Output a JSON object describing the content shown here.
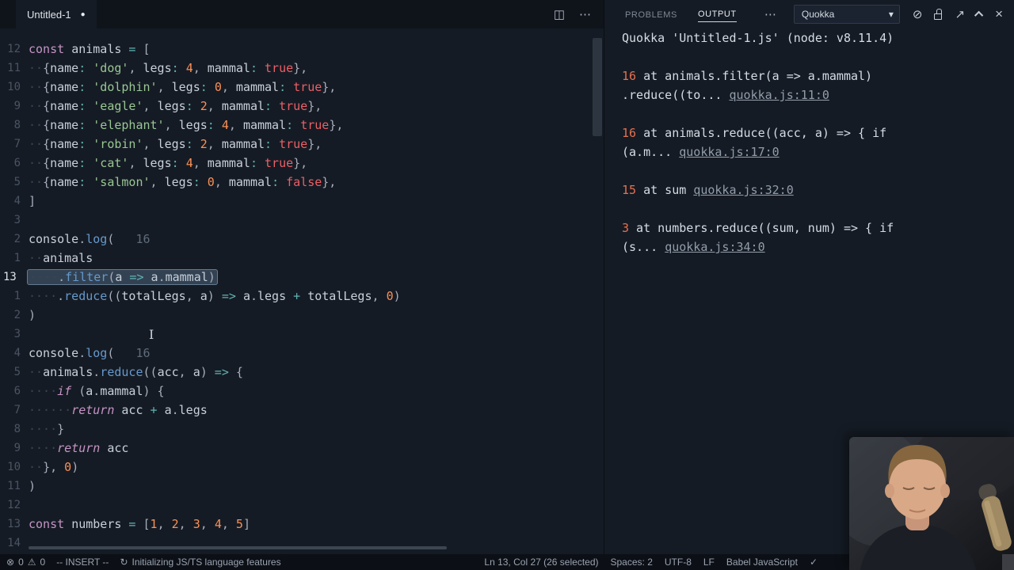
{
  "tab": {
    "title": "Untitled-1",
    "dirty_dot": "●"
  },
  "icons": {
    "split_editor": "◫",
    "more": "⋯",
    "caret": "▾",
    "clear_output": "⊘",
    "open_log": "↗",
    "close_panel": "×"
  },
  "editor": {
    "lines": [
      {
        "n": "12",
        "t": [
          [
            "kw",
            "const"
          ],
          [
            "pn",
            " "
          ],
          [
            "id",
            "animals"
          ],
          [
            "op",
            " = "
          ],
          [
            "pn",
            "["
          ]
        ]
      },
      {
        "n": "11",
        "t": [
          [
            "ws",
            "··"
          ],
          [
            "pn",
            "{"
          ],
          [
            "id",
            "name"
          ],
          [
            "op",
            ":"
          ],
          [
            "pn",
            " "
          ],
          [
            "str",
            "'dog'"
          ],
          [
            "pn",
            ", "
          ],
          [
            "id",
            "legs"
          ],
          [
            "op",
            ":"
          ],
          [
            "pn",
            " "
          ],
          [
            "num",
            "4"
          ],
          [
            "pn",
            ", "
          ],
          [
            "id",
            "mammal"
          ],
          [
            "op",
            ":"
          ],
          [
            "pn",
            " "
          ],
          [
            "bool",
            "true"
          ],
          [
            "pn",
            "},"
          ]
        ]
      },
      {
        "n": "10",
        "t": [
          [
            "ws",
            "··"
          ],
          [
            "pn",
            "{"
          ],
          [
            "id",
            "name"
          ],
          [
            "op",
            ":"
          ],
          [
            "pn",
            " "
          ],
          [
            "str",
            "'dolphin'"
          ],
          [
            "pn",
            ", "
          ],
          [
            "id",
            "legs"
          ],
          [
            "op",
            ":"
          ],
          [
            "pn",
            " "
          ],
          [
            "num",
            "0"
          ],
          [
            "pn",
            ", "
          ],
          [
            "id",
            "mammal"
          ],
          [
            "op",
            ":"
          ],
          [
            "pn",
            " "
          ],
          [
            "bool",
            "true"
          ],
          [
            "pn",
            "},"
          ]
        ]
      },
      {
        "n": "9",
        "t": [
          [
            "ws",
            "··"
          ],
          [
            "pn",
            "{"
          ],
          [
            "id",
            "name"
          ],
          [
            "op",
            ":"
          ],
          [
            "pn",
            " "
          ],
          [
            "str",
            "'eagle'"
          ],
          [
            "pn",
            ", "
          ],
          [
            "id",
            "legs"
          ],
          [
            "op",
            ":"
          ],
          [
            "pn",
            " "
          ],
          [
            "num",
            "2"
          ],
          [
            "pn",
            ", "
          ],
          [
            "id",
            "mammal"
          ],
          [
            "op",
            ":"
          ],
          [
            "pn",
            " "
          ],
          [
            "bool",
            "true"
          ],
          [
            "pn",
            "},"
          ]
        ]
      },
      {
        "n": "8",
        "t": [
          [
            "ws",
            "··"
          ],
          [
            "pn",
            "{"
          ],
          [
            "id",
            "name"
          ],
          [
            "op",
            ":"
          ],
          [
            "pn",
            " "
          ],
          [
            "str",
            "'elephant'"
          ],
          [
            "pn",
            ", "
          ],
          [
            "id",
            "legs"
          ],
          [
            "op",
            ":"
          ],
          [
            "pn",
            " "
          ],
          [
            "num",
            "4"
          ],
          [
            "pn",
            ", "
          ],
          [
            "id",
            "mammal"
          ],
          [
            "op",
            ":"
          ],
          [
            "pn",
            " "
          ],
          [
            "bool",
            "true"
          ],
          [
            "pn",
            "},"
          ]
        ]
      },
      {
        "n": "7",
        "t": [
          [
            "ws",
            "··"
          ],
          [
            "pn",
            "{"
          ],
          [
            "id",
            "name"
          ],
          [
            "op",
            ":"
          ],
          [
            "pn",
            " "
          ],
          [
            "str",
            "'robin'"
          ],
          [
            "pn",
            ", "
          ],
          [
            "id",
            "legs"
          ],
          [
            "op",
            ":"
          ],
          [
            "pn",
            " "
          ],
          [
            "num",
            "2"
          ],
          [
            "pn",
            ", "
          ],
          [
            "id",
            "mammal"
          ],
          [
            "op",
            ":"
          ],
          [
            "pn",
            " "
          ],
          [
            "bool",
            "true"
          ],
          [
            "pn",
            "},"
          ]
        ]
      },
      {
        "n": "6",
        "t": [
          [
            "ws",
            "··"
          ],
          [
            "pn",
            "{"
          ],
          [
            "id",
            "name"
          ],
          [
            "op",
            ":"
          ],
          [
            "pn",
            " "
          ],
          [
            "str",
            "'cat'"
          ],
          [
            "pn",
            ", "
          ],
          [
            "id",
            "legs"
          ],
          [
            "op",
            ":"
          ],
          [
            "pn",
            " "
          ],
          [
            "num",
            "4"
          ],
          [
            "pn",
            ", "
          ],
          [
            "id",
            "mammal"
          ],
          [
            "op",
            ":"
          ],
          [
            "pn",
            " "
          ],
          [
            "bool",
            "true"
          ],
          [
            "pn",
            "},"
          ]
        ]
      },
      {
        "n": "5",
        "t": [
          [
            "ws",
            "··"
          ],
          [
            "pn",
            "{"
          ],
          [
            "id",
            "name"
          ],
          [
            "op",
            ":"
          ],
          [
            "pn",
            " "
          ],
          [
            "str",
            "'salmon'"
          ],
          [
            "pn",
            ", "
          ],
          [
            "id",
            "legs"
          ],
          [
            "op",
            ":"
          ],
          [
            "pn",
            " "
          ],
          [
            "num",
            "0"
          ],
          [
            "pn",
            ", "
          ],
          [
            "id",
            "mammal"
          ],
          [
            "op",
            ":"
          ],
          [
            "pn",
            " "
          ],
          [
            "bool",
            "false"
          ],
          [
            "pn",
            "},"
          ]
        ]
      },
      {
        "n": "4",
        "t": [
          [
            "pn",
            "]"
          ]
        ]
      },
      {
        "n": "3",
        "t": []
      },
      {
        "n": "2",
        "t": [
          [
            "id",
            "console"
          ],
          [
            "pn",
            "."
          ],
          [
            "fn",
            "log"
          ],
          [
            "pn",
            "("
          ],
          [
            "dim",
            "   16"
          ]
        ]
      },
      {
        "n": "1",
        "t": [
          [
            "ws",
            "··"
          ],
          [
            "id",
            "animals"
          ]
        ]
      },
      {
        "n": "13",
        "cur": 1,
        "sel": 1,
        "t": [
          [
            "ws",
            "····"
          ],
          [
            "pn",
            "."
          ],
          [
            "fn",
            "filter"
          ],
          [
            "pn",
            "("
          ],
          [
            "id",
            "a"
          ],
          [
            "op",
            " => "
          ],
          [
            "id",
            "a"
          ],
          [
            "pn",
            "."
          ],
          [
            "id",
            "mammal"
          ],
          [
            "pn",
            ")"
          ]
        ]
      },
      {
        "n": "1",
        "t": [
          [
            "ws",
            "····"
          ],
          [
            "pn",
            "."
          ],
          [
            "fn",
            "reduce"
          ],
          [
            "pn",
            "(("
          ],
          [
            "id",
            "totalLegs"
          ],
          [
            "pn",
            ", "
          ],
          [
            "id",
            "a"
          ],
          [
            "pn",
            ")"
          ],
          [
            "op",
            " => "
          ],
          [
            "id",
            "a"
          ],
          [
            "pn",
            "."
          ],
          [
            "id",
            "legs"
          ],
          [
            "op",
            " + "
          ],
          [
            "id",
            "totalLegs"
          ],
          [
            "pn",
            ", "
          ],
          [
            "num",
            "0"
          ],
          [
            "pn",
            ")"
          ]
        ]
      },
      {
        "n": "2",
        "t": [
          [
            "pn",
            ")"
          ]
        ]
      },
      {
        "n": "3",
        "t": []
      },
      {
        "n": "4",
        "t": [
          [
            "id",
            "console"
          ],
          [
            "pn",
            "."
          ],
          [
            "fn",
            "log"
          ],
          [
            "pn",
            "("
          ],
          [
            "dim",
            "   16"
          ]
        ]
      },
      {
        "n": "5",
        "t": [
          [
            "ws",
            "··"
          ],
          [
            "id",
            "animals"
          ],
          [
            "pn",
            "."
          ],
          [
            "fn",
            "reduce"
          ],
          [
            "pn",
            "(("
          ],
          [
            "id",
            "acc"
          ],
          [
            "pn",
            ", "
          ],
          [
            "id",
            "a"
          ],
          [
            "pn",
            ")"
          ],
          [
            "op",
            " => "
          ],
          [
            "pn",
            "{"
          ]
        ]
      },
      {
        "n": "6",
        "t": [
          [
            "ws",
            "····"
          ],
          [
            "kwi",
            "if"
          ],
          [
            "pn",
            " ("
          ],
          [
            "id",
            "a"
          ],
          [
            "pn",
            "."
          ],
          [
            "id",
            "mammal"
          ],
          [
            "pn",
            ") {"
          ]
        ]
      },
      {
        "n": "7",
        "t": [
          [
            "ws",
            "······"
          ],
          [
            "kwi",
            "return"
          ],
          [
            "pn",
            " "
          ],
          [
            "id",
            "acc"
          ],
          [
            "op",
            " + "
          ],
          [
            "id",
            "a"
          ],
          [
            "pn",
            "."
          ],
          [
            "id",
            "legs"
          ]
        ]
      },
      {
        "n": "8",
        "t": [
          [
            "ws",
            "····"
          ],
          [
            "pn",
            "}"
          ]
        ]
      },
      {
        "n": "9",
        "t": [
          [
            "ws",
            "····"
          ],
          [
            "kwi",
            "return"
          ],
          [
            "pn",
            " "
          ],
          [
            "id",
            "acc"
          ]
        ]
      },
      {
        "n": "10",
        "t": [
          [
            "ws",
            "··"
          ],
          [
            "pn",
            "}, "
          ],
          [
            "num",
            "0"
          ],
          [
            "pn",
            ")"
          ]
        ]
      },
      {
        "n": "11",
        "t": [
          [
            "pn",
            ")"
          ]
        ]
      },
      {
        "n": "12",
        "t": []
      },
      {
        "n": "13",
        "t": [
          [
            "kw",
            "const"
          ],
          [
            "pn",
            " "
          ],
          [
            "id",
            "numbers"
          ],
          [
            "op",
            " = "
          ],
          [
            "pn",
            "["
          ],
          [
            "num",
            "1"
          ],
          [
            "pn",
            ", "
          ],
          [
            "num",
            "2"
          ],
          [
            "pn",
            ", "
          ],
          [
            "num",
            "3"
          ],
          [
            "pn",
            ", "
          ],
          [
            "num",
            "4"
          ],
          [
            "pn",
            ", "
          ],
          [
            "num",
            "5"
          ],
          [
            "pn",
            "]"
          ]
        ]
      },
      {
        "n": "14",
        "t": []
      }
    ]
  },
  "panel": {
    "tabs": [
      {
        "label": "PROBLEMS",
        "active": false
      },
      {
        "label": "OUTPUT",
        "active": true
      }
    ],
    "channel": "Quokka",
    "output": {
      "blocks": [
        {
          "lines": [
            [
              [
                "txt",
                "Quokka 'Untitled-1.js' (node: v8.11.4)"
              ]
            ]
          ]
        },
        {
          "lines": [
            [
              [
                "val",
                "16"
              ],
              [
                "txt",
                " at animals.filter(a => a.mammal)"
              ]
            ],
            [
              [
                "txt",
                ".reduce((to... "
              ],
              [
                "link",
                "quokka.js:11:0"
              ]
            ]
          ]
        },
        {
          "lines": [
            [
              [
                "val",
                "16"
              ],
              [
                "txt",
                " at animals.reduce((acc, a) => { if"
              ]
            ],
            [
              [
                "txt",
                "(a.m... "
              ],
              [
                "link",
                "quokka.js:17:0"
              ]
            ]
          ]
        },
        {
          "lines": [
            [
              [
                "val",
                "15"
              ],
              [
                "txt",
                " at sum "
              ],
              [
                "link",
                "quokka.js:32:0"
              ]
            ]
          ]
        },
        {
          "lines": [
            [
              [
                "val",
                "3"
              ],
              [
                "txt",
                " at numbers.reduce((sum, num) => { if"
              ]
            ],
            [
              [
                "txt",
                "(s... "
              ],
              [
                "link",
                "quokka.js:34:0"
              ]
            ]
          ]
        }
      ]
    }
  },
  "statusbar": {
    "left": [
      {
        "name": "problems-status",
        "icon": "error-icon",
        "glyph": "⊗",
        "text": "0",
        "icon2": "warning-icon",
        "glyph2": "⚠",
        "text2": "0"
      },
      {
        "name": "vim-mode-indicator",
        "text": "-- INSERT --"
      },
      {
        "name": "language-features-status",
        "icon": "sync-icon",
        "glyph": "↻",
        "spin": true,
        "text": "Initializing JS/TS language features"
      }
    ],
    "right": [
      {
        "name": "cursor-position",
        "text": "Ln 13, Col 27 (26 selected)"
      },
      {
        "name": "indentation-status",
        "text": "Spaces: 2"
      },
      {
        "name": "encoding-status",
        "text": "UTF-8"
      },
      {
        "name": "eol-status",
        "text": "LF"
      },
      {
        "name": "language-mode",
        "text": "Babel JavaScript"
      },
      {
        "name": "quokka-check-status",
        "icon": "check-icon",
        "glyph": "✓"
      }
    ]
  }
}
